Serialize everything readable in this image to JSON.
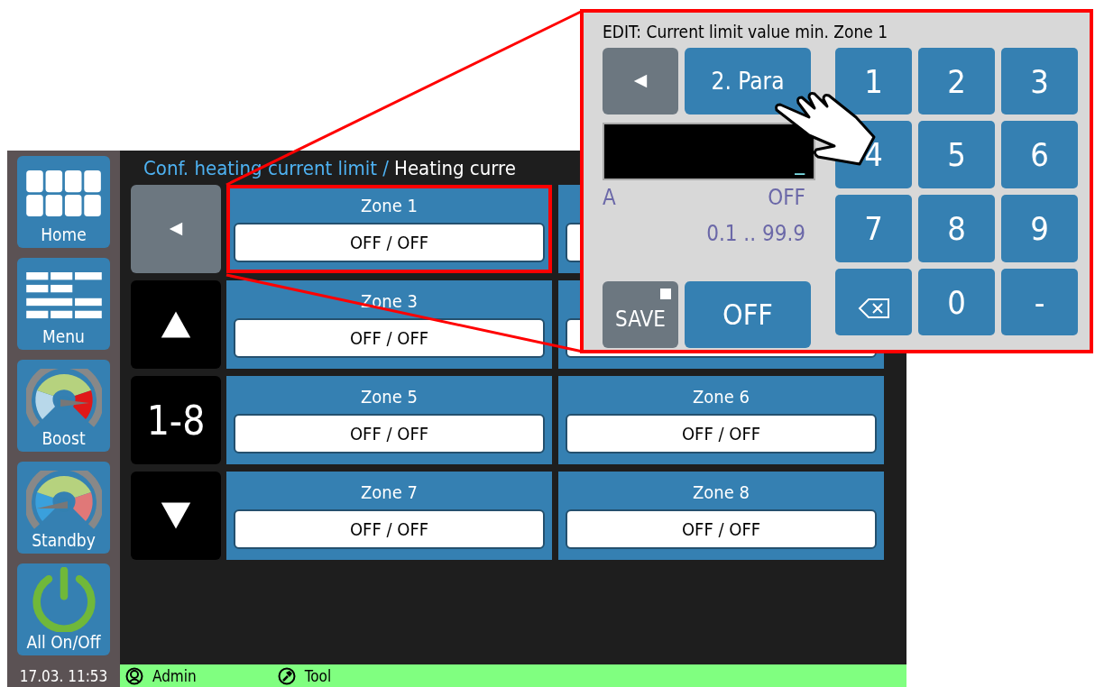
{
  "header": {
    "parent": "Conf. heating current limit /",
    "current": "Heating curre"
  },
  "sidebar": [
    {
      "kind": "home",
      "label": "Home"
    },
    {
      "kind": "menu",
      "label": "Menu"
    },
    {
      "kind": "boost",
      "label": "Boost"
    },
    {
      "kind": "standby",
      "label": "Standby"
    },
    {
      "kind": "power",
      "label": "All On/Off"
    }
  ],
  "nav": {
    "range": "1-8"
  },
  "zones": [
    {
      "name": "Zone 1",
      "value": "OFF / OFF",
      "highlighted": true
    },
    {
      "highlighted": false
    },
    {
      "name": "Zone 3",
      "value": "OFF / OFF",
      "highlighted": false
    },
    {
      "highlighted": false
    },
    {
      "name": "Zone 5",
      "value": "OFF / OFF",
      "highlighted": false
    },
    {
      "name": "Zone 6",
      "value": "OFF / OFF",
      "highlighted": false
    },
    {
      "name": "Zone 7",
      "value": "OFF / OFF",
      "highlighted": false
    },
    {
      "name": "Zone 8",
      "value": "OFF / OFF",
      "highlighted": false
    }
  ],
  "status_bar": {
    "datetime": "17.03. 11:53",
    "user": "Admin",
    "mode": "Tool"
  },
  "edit_dialog": {
    "title": "EDIT: Current limit value min. Zone 1",
    "para_button": "2. Para",
    "cursor": "_",
    "unit": "A",
    "current_value": "OFF",
    "range": "0.1 .. 99.9",
    "save_button": "SAVE",
    "off_button": "OFF",
    "keys": [
      {
        "kind": "digit",
        "label": "1"
      },
      {
        "kind": "digit",
        "label": "2"
      },
      {
        "kind": "digit",
        "label": "3"
      },
      {
        "kind": "digit",
        "label": "4"
      },
      {
        "kind": "digit",
        "label": "5"
      },
      {
        "kind": "digit",
        "label": "6"
      },
      {
        "kind": "digit",
        "label": "7"
      },
      {
        "kind": "digit",
        "label": "8"
      },
      {
        "kind": "digit",
        "label": "9"
      },
      {
        "kind": "backspace"
      },
      {
        "kind": "digit",
        "label": "0"
      },
      {
        "kind": "digit",
        "label": "-"
      }
    ]
  }
}
